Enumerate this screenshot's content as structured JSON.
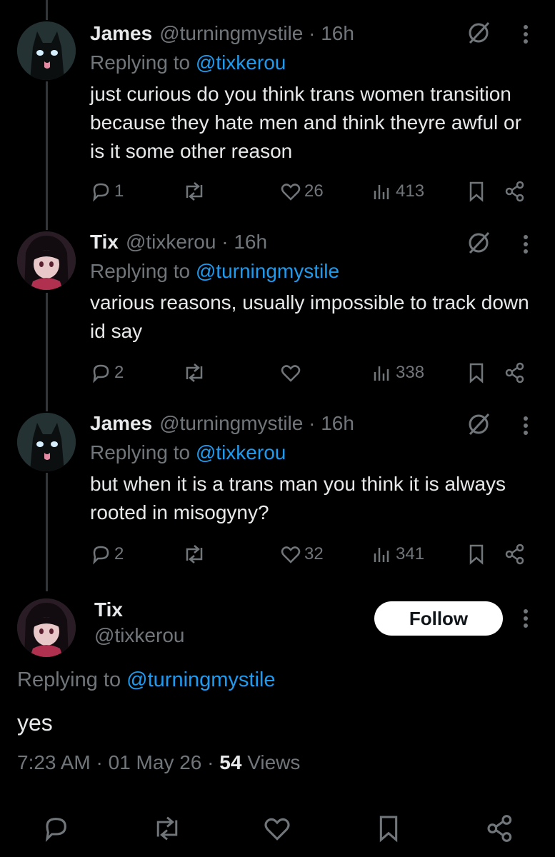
{
  "replies": [
    {
      "name": "James",
      "handle": "@turningmystile",
      "time": "16h",
      "replying_label": "Replying to",
      "replying_to": "@tixkerou",
      "text": "just curious do you think trans women transition because they  hate men and think theyre awful or is it some other reason",
      "replies_count": "1",
      "likes_count": "26",
      "views_count": "413"
    },
    {
      "name": "Tix",
      "handle": "@tixkerou",
      "time": "16h",
      "replying_label": "Replying to",
      "replying_to": "@turningmystile",
      "text": "various reasons, usually impossible to track down id say",
      "replies_count": "2",
      "likes_count": "",
      "views_count": "338"
    },
    {
      "name": "James",
      "handle": "@turningmystile",
      "time": "16h",
      "replying_label": "Replying to",
      "replying_to": "@tixkerou",
      "text": "but when it is a trans man you think it is always rooted in misogyny?",
      "replies_count": "2",
      "likes_count": "32",
      "views_count": "341"
    }
  ],
  "main_post": {
    "name": "Tix",
    "handle": "@tixkerou",
    "follow_label": "Follow",
    "replying_label": "Replying to",
    "replying_to": "@turningmystile",
    "text": "yes",
    "time": "7:23 AM",
    "date": "01 May 26",
    "views_count": "54",
    "views_label": "Views"
  },
  "colors": {
    "background": "#000000",
    "text": "#e7e9ea",
    "muted": "#71767b",
    "link": "#1d9bf0",
    "divider": "#333639"
  }
}
